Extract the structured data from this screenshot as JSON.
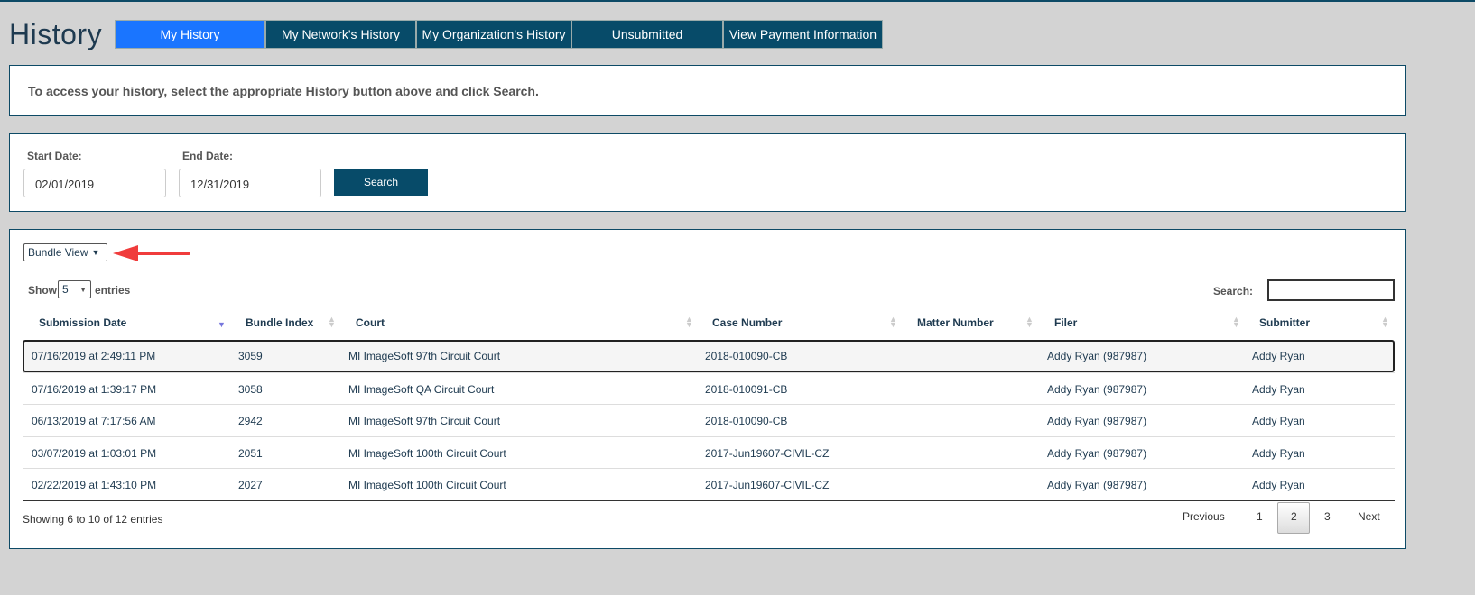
{
  "header": {
    "title": "History",
    "tabs": [
      {
        "label": "My History",
        "active": true
      },
      {
        "label": "My Network's History"
      },
      {
        "label": "My Organization's History"
      },
      {
        "label": "Unsubmitted"
      },
      {
        "label": "View Payment Information"
      }
    ]
  },
  "notice": "To access your history, select the appropriate History button above and click Search.",
  "filters": {
    "start_label": "Start Date:",
    "start_value": "02/01/2019",
    "end_label": "End Date:",
    "end_value": "12/31/2019",
    "search_button": "Search"
  },
  "results": {
    "view_select": "Bundle View",
    "show_label": "Show",
    "entries_value": "5",
    "entries_label": "entries",
    "search_label": "Search:",
    "search_value": "",
    "columns": [
      "Submission Date",
      "Bundle Index",
      "Court",
      "Case Number",
      "Matter Number",
      "Filer",
      "Submitter"
    ],
    "sorted_column": "Submission Date",
    "sort_direction": "descending",
    "rows": [
      [
        "07/16/2019 at 2:49:11 PM",
        "3059",
        "MI ImageSoft 97th Circuit Court",
        "2018-010090-CB",
        "",
        "Addy Ryan (987987)",
        "Addy Ryan"
      ],
      [
        "07/16/2019 at 1:39:17 PM",
        "3058",
        "MI ImageSoft QA Circuit Court",
        "2018-010091-CB",
        "",
        "Addy Ryan (987987)",
        "Addy Ryan"
      ],
      [
        "06/13/2019 at 7:17:56 AM",
        "2942",
        "MI ImageSoft 97th Circuit Court",
        "2018-010090-CB",
        "",
        "Addy Ryan (987987)",
        "Addy Ryan"
      ],
      [
        "03/07/2019 at 1:03:01 PM",
        "2051",
        "MI ImageSoft 100th Circuit Court",
        "2017-Jun19607-CIVIL-CZ",
        "",
        "Addy Ryan (987987)",
        "Addy Ryan"
      ],
      [
        "02/22/2019 at 1:43:10 PM",
        "2027",
        "MI ImageSoft 100th Circuit Court",
        "2017-Jun19607-CIVIL-CZ",
        "",
        "Addy Ryan (987987)",
        "Addy Ryan"
      ]
    ],
    "info": "Showing 6 to 10 of 12 entries",
    "pagination": {
      "previous": "Previous",
      "pages": [
        "1",
        "2",
        "3"
      ],
      "current": "2",
      "next": "Next"
    }
  },
  "colors": {
    "tab_active": "#1a75ff",
    "tab": "#074b69",
    "annotation_arrow": "#f03c3c"
  }
}
